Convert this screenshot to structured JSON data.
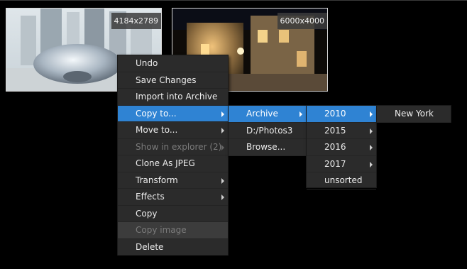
{
  "thumbnails": [
    {
      "dimensions": "4184x2789"
    },
    {
      "dimensions": "6000x4000"
    }
  ],
  "context_menu": {
    "items": [
      {
        "label": "Undo"
      },
      {
        "label": "Save Changes"
      },
      {
        "label": "Import into Archive"
      },
      {
        "label": "Copy to..."
      },
      {
        "label": "Move to..."
      },
      {
        "label": "Show in explorer (2)"
      },
      {
        "label": "Clone As JPEG"
      },
      {
        "label": "Transform"
      },
      {
        "label": "Effects"
      },
      {
        "label": "Copy"
      },
      {
        "label": "Copy image"
      },
      {
        "label": "Delete"
      }
    ]
  },
  "copy_to_menu": {
    "items": [
      {
        "label": "Archive"
      },
      {
        "label": "D:/Photos3"
      },
      {
        "label": "Browse..."
      }
    ]
  },
  "archive_menu": {
    "items": [
      {
        "label": "2010"
      },
      {
        "label": "2015"
      },
      {
        "label": "2016"
      },
      {
        "label": "2017"
      },
      {
        "label": "unsorted"
      }
    ]
  },
  "year_menu": {
    "items": [
      {
        "label": "New York"
      }
    ]
  },
  "colors": {
    "highlight": "#2f83d3",
    "menu_bg": "#2b2b2b",
    "disabled_text": "#7b7b7b"
  }
}
